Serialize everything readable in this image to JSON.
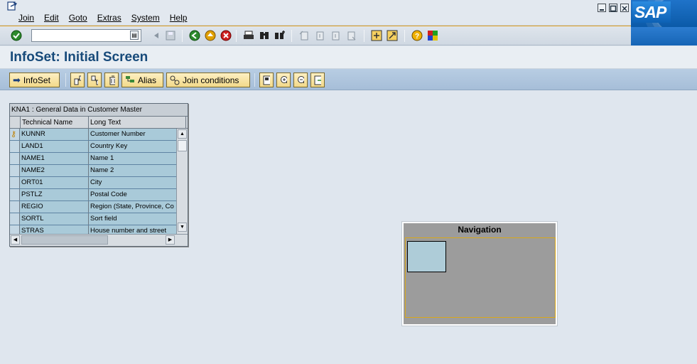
{
  "menu": {
    "items": [
      "Join",
      "Edit",
      "Goto",
      "Extras",
      "System",
      "Help"
    ]
  },
  "window": {
    "logo_text": "SAP"
  },
  "toolbar": {
    "command_value": ""
  },
  "page": {
    "title": "InfoSet: Initial Screen"
  },
  "app_toolbar": {
    "infoset_label": "InfoSet",
    "alias_label": "Alias",
    "join_conditions_label": "Join conditions"
  },
  "table": {
    "title": "KNA1 : General Data in Customer Master",
    "columns": [
      "Technical Name",
      "Long Text"
    ],
    "rows": [
      {
        "tech": "KUNNR",
        "text": "Customer Number",
        "key": true
      },
      {
        "tech": "LAND1",
        "text": "Country Key",
        "key": false
      },
      {
        "tech": "NAME1",
        "text": "Name 1",
        "key": false
      },
      {
        "tech": "NAME2",
        "text": "Name 2",
        "key": false
      },
      {
        "tech": "ORT01",
        "text": "City",
        "key": false
      },
      {
        "tech": "PSTLZ",
        "text": "Postal Code",
        "key": false
      },
      {
        "tech": "REGIO",
        "text": "Region (State, Province, Co",
        "key": false
      },
      {
        "tech": "SORTL",
        "text": "Sort field",
        "key": false
      },
      {
        "tech": "STRAS",
        "text": "House number and street",
        "key": false
      }
    ]
  },
  "navigation": {
    "title": "Navigation"
  },
  "colors": {
    "title_text": "#174a7a",
    "accent_line": "#e0a020",
    "button_bg": "#f2d98a",
    "table_cell": "#a9cad9",
    "nav_bg": "#9c9c9c"
  }
}
